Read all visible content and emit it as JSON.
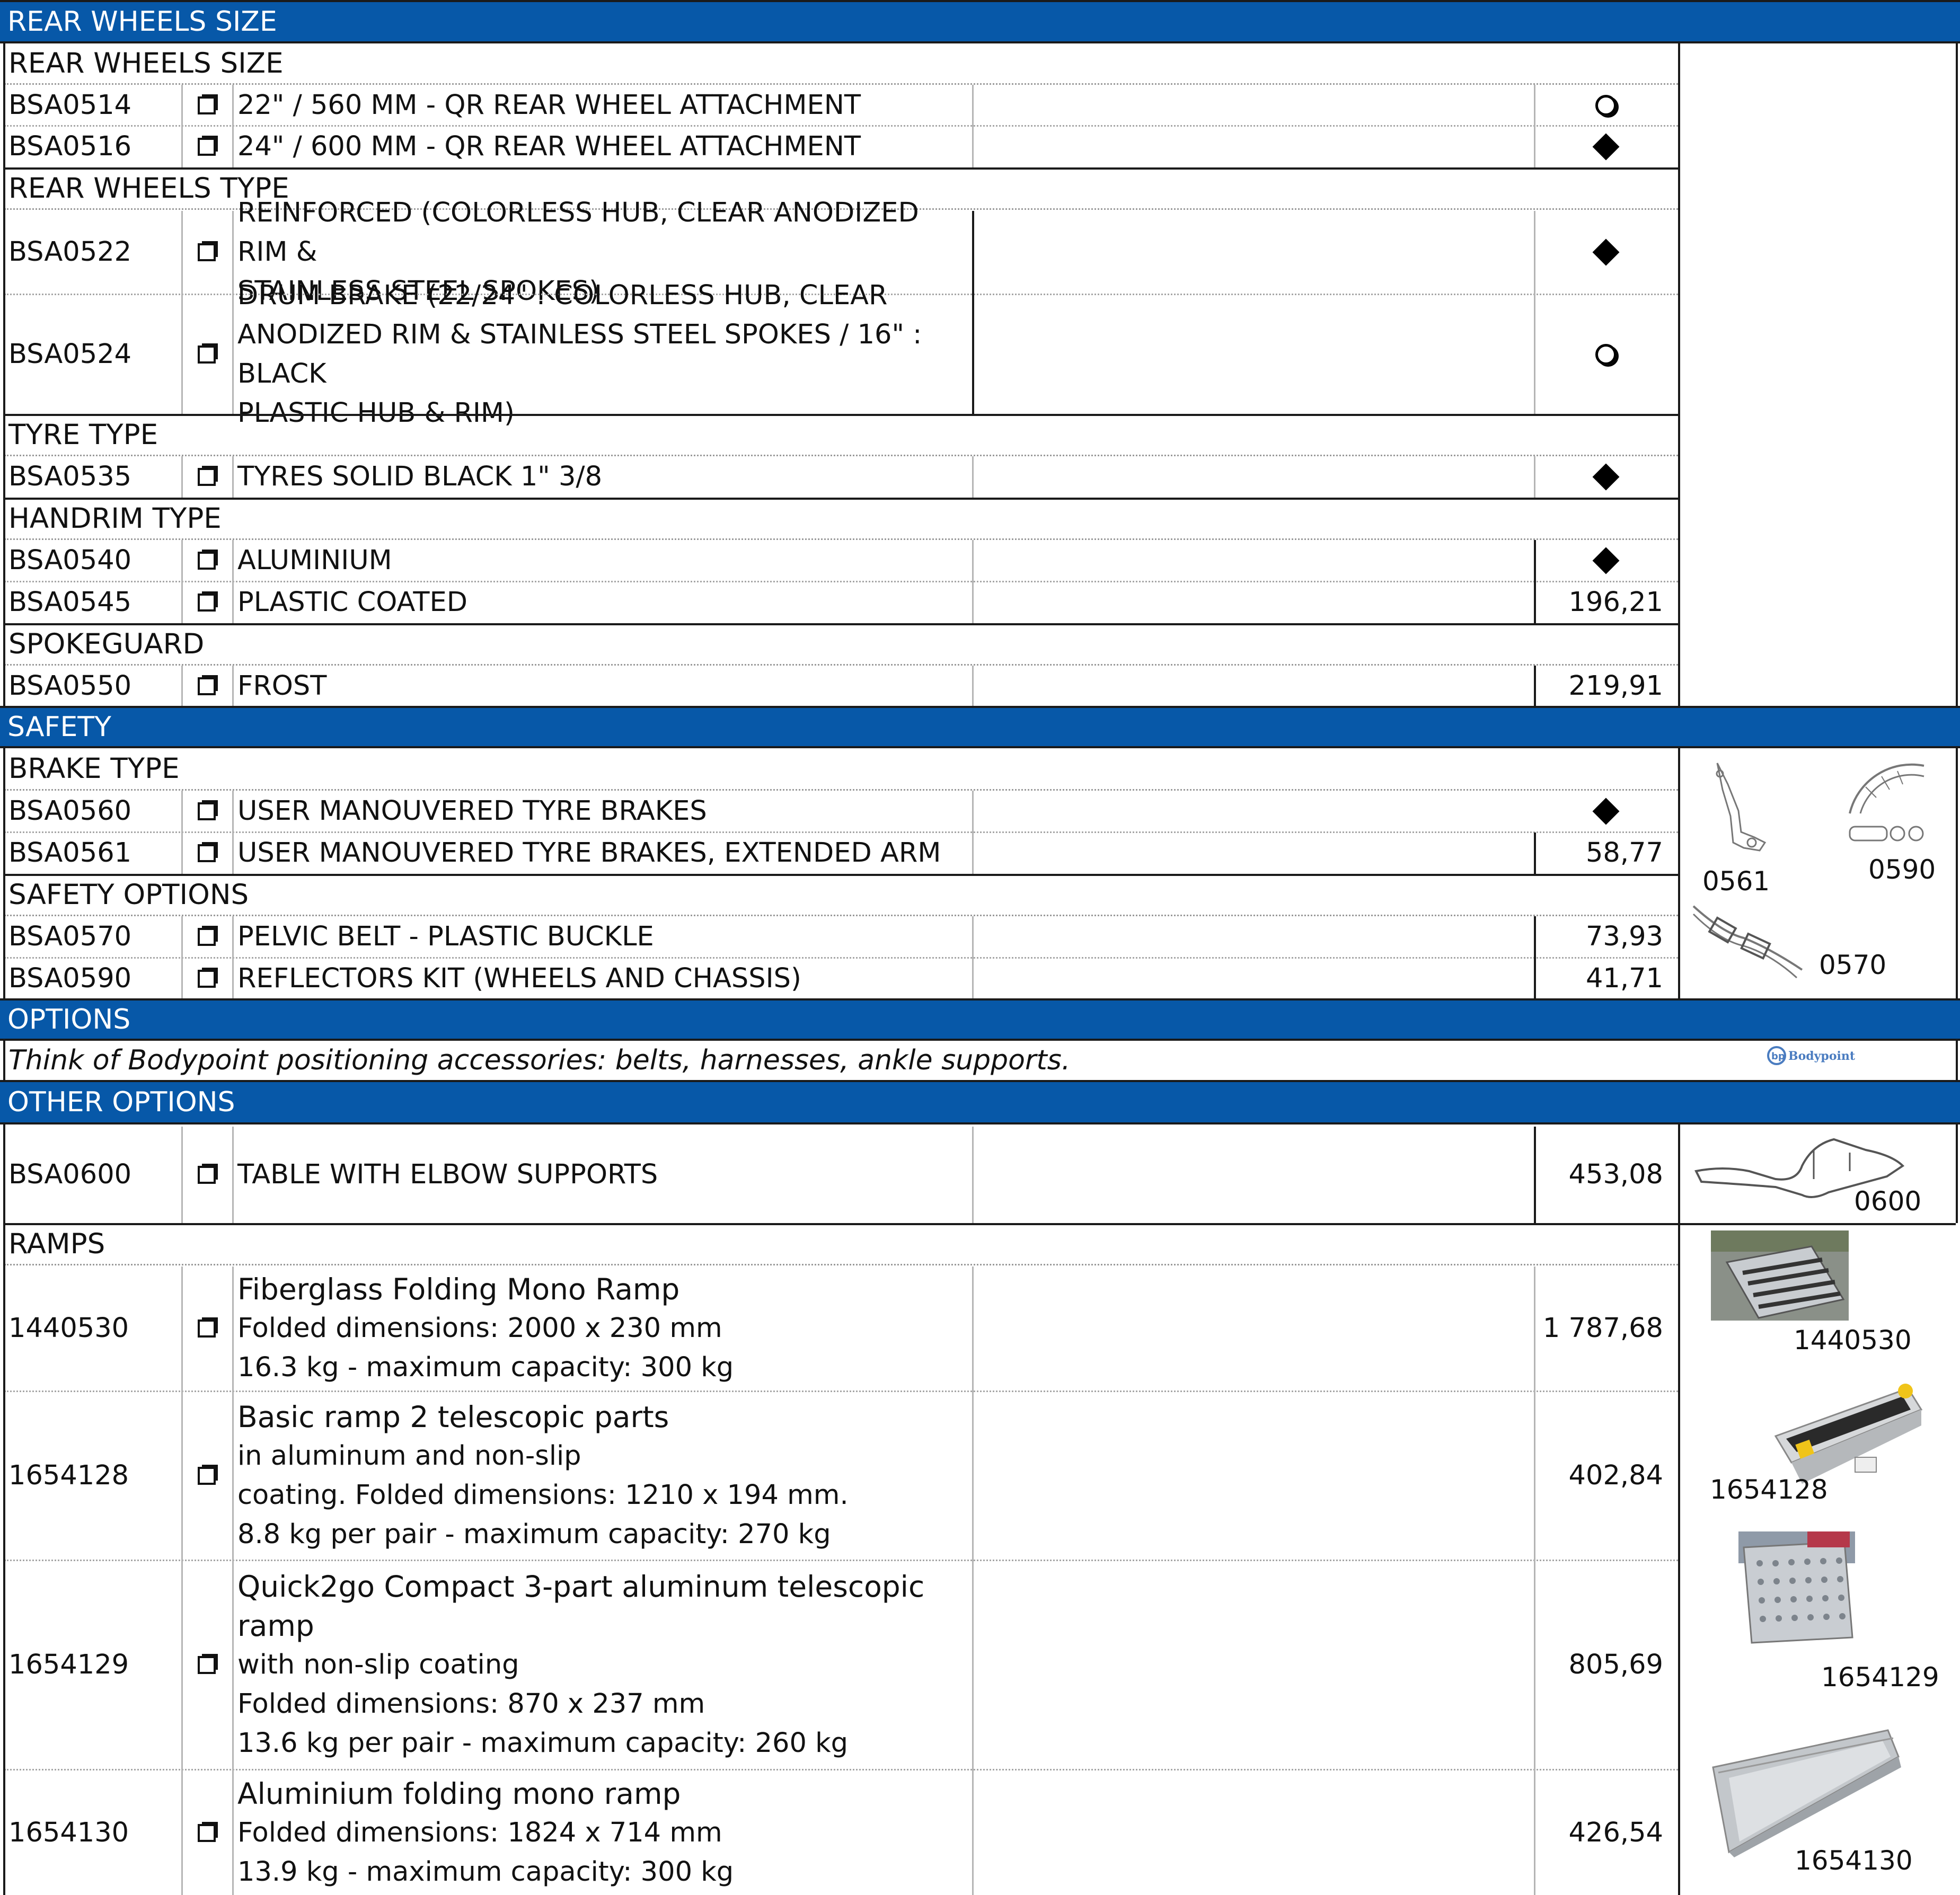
{
  "sections": {
    "rear_wheels_band": "REAR WHEELS SIZE",
    "safety_band": "SAFETY",
    "options_band": "OPTIONS",
    "other_options_band": "OTHER OPTIONS"
  },
  "groups": {
    "rear_wheels_size": "REAR WHEELS SIZE",
    "rear_wheels_type": "REAR WHEELS TYPE",
    "tyre_type": "TYRE TYPE",
    "handrim_type": "HANDRIM TYPE",
    "spokeguard": "SPOKEGUARD",
    "brake_type": "BRAKE TYPE",
    "safety_options": "SAFETY OPTIONS",
    "ramps": "RAMPS"
  },
  "rows": {
    "bsa0514": {
      "code": "BSA0514",
      "desc": "22\" / 560 MM - QR REAR WHEEL ATTACHMENT",
      "symbol": "optional-circle"
    },
    "bsa0516": {
      "code": "BSA0516",
      "desc": "24\" / 600 MM - QR REAR WHEEL ATTACHMENT",
      "symbol": "standard-diamond"
    },
    "bsa0522": {
      "code": "BSA0522",
      "desc1": "REINFORCED (COLORLESS HUB, CLEAR ANODIZED RIM &",
      "desc2": "STAINLESS STEEL SPOKES)",
      "symbol": "standard-diamond"
    },
    "bsa0524": {
      "code": "BSA0524",
      "desc1": "DRUM BRAKE (22/24\" : COLORLESS HUB, CLEAR",
      "desc2": "ANODIZED RIM & STAINLESS STEEL SPOKES / 16\" : BLACK",
      "desc3": "PLASTIC HUB & RIM)",
      "symbol": "optional-circle"
    },
    "bsa0535": {
      "code": "BSA0535",
      "desc": "TYRES SOLID BLACK 1\" 3/8",
      "symbol": "standard-diamond"
    },
    "bsa0540": {
      "code": "BSA0540",
      "desc": "ALUMINIUM",
      "symbol": "standard-diamond"
    },
    "bsa0545": {
      "code": "BSA0545",
      "desc": "PLASTIC COATED",
      "price": "196,21"
    },
    "bsa0550": {
      "code": "BSA0550",
      "desc": "FROST",
      "price": "219,91"
    },
    "bsa0560": {
      "code": "BSA0560",
      "desc": "USER MANOUVERED TYRE BRAKES",
      "symbol": "standard-diamond"
    },
    "bsa0561": {
      "code": "BSA0561",
      "desc": "USER MANOUVERED TYRE BRAKES, EXTENDED ARM",
      "price": "58,77"
    },
    "bsa0570": {
      "code": "BSA0570",
      "desc": "PELVIC BELT - PLASTIC BUCKLE",
      "price": "73,93"
    },
    "bsa0590": {
      "code": "BSA0590",
      "desc": "REFLECTORS KIT (WHEELS AND CHASSIS)",
      "price": "41,71"
    },
    "bsa0600": {
      "code": "BSA0600",
      "desc": "TABLE WITH ELBOW SUPPORTS",
      "price": "453,08"
    },
    "r1440530": {
      "code": "1440530",
      "title": "Fiberglass Folding Mono Ramp",
      "line2": "Folded dimensions: 2000 x 230 mm",
      "line3": "16.3 kg - maximum capacity: 300 kg",
      "price": "1 787,68"
    },
    "r1654128": {
      "code": "1654128",
      "title": "Basic ramp 2 telescopic parts",
      "title_rest": " in aluminum and non-slip",
      "line2": "coating. Folded dimensions: 1210 x 194 mm.",
      "line3": "8.8 kg per pair - maximum capacity: 270 kg",
      "price": "402,84"
    },
    "r1654129": {
      "code": "1654129",
      "title": "Quick2go Compact 3-part aluminum telescopic ramp",
      "line2": "with non-slip coating",
      "line3": "Folded dimensions: 870 x 237 mm",
      "line4": "13.6 kg per pair - maximum capacity: 260 kg",
      "price": "805,69"
    },
    "r1654130": {
      "code": "1654130",
      "title": "Aluminium folding mono ramp",
      "line2": "Folded dimensions: 1824 x 714 mm",
      "line3": "13.9 kg - maximum capacity: 300 kg",
      "price": "426,54"
    }
  },
  "options_note": "Think of Bodypoint positioning accessories: belts, harnesses, ankle supports.",
  "bodypoint_logo": "Bodypoint",
  "image_labels": {
    "brake": "0561",
    "reflector": "0590",
    "belt": "0570",
    "table": "0600",
    "ramp_a": "1440530",
    "ramp_b": "1654128",
    "ramp_c": "1654129",
    "ramp_d": "1654130"
  },
  "colors": {
    "band": "#0758a8",
    "band_text": "#ffffff"
  },
  "icons": {
    "checkbox": "checkbox-icon",
    "standard": "diamond-icon",
    "optional": "circle-icon"
  }
}
